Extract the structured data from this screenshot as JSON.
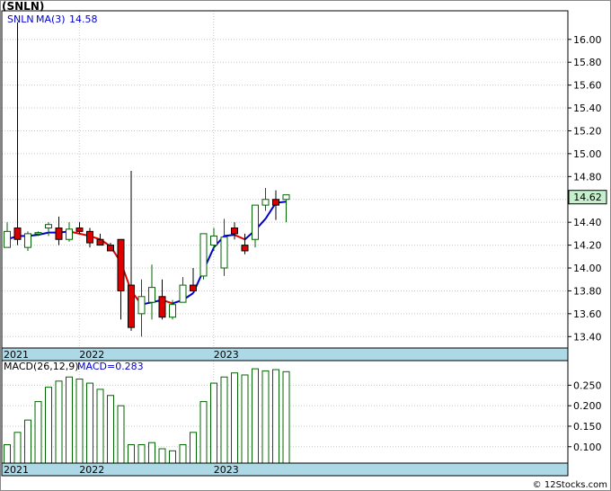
{
  "chart_data": {
    "type": "candlestick",
    "title": "(SNLN)",
    "ticker": "SNLN",
    "ma_label": "MA(3)",
    "ma_value": "14.58",
    "last_price": "14.62",
    "macd_label": "MACD(26,12,9)",
    "macd_value": "MACD=0.283",
    "year_labels": [
      {
        "label": "2021",
        "index": 0
      },
      {
        "label": "2022",
        "index": 7.5
      },
      {
        "label": "2023",
        "index": 20.5
      }
    ],
    "price_axis": {
      "ylim": [
        13.3,
        16.25
      ],
      "ticks": [
        "16.00",
        "15.80",
        "15.60",
        "15.40",
        "15.20",
        "15.00",
        "14.80",
        "14.60",
        "14.40",
        "14.20",
        "14.00",
        "13.80",
        "13.60",
        "13.40"
      ]
    },
    "macd_axis": {
      "ylim": [
        0.06,
        0.31
      ],
      "ticks": [
        "0.250",
        "0.200",
        "0.150",
        "0.100"
      ]
    },
    "colors": {
      "up_fill": "#ffffff",
      "up_stroke": "#006400",
      "down_fill": "#dd0000",
      "ma_up": "#0000cc",
      "ma_down": "#dd0000",
      "band": "#add8e6",
      "macd_stroke": "#006400",
      "grid": "#c8c8c8",
      "last_price_bg": "#c6efce"
    },
    "candles": [
      {
        "o": 14.18,
        "h": 14.4,
        "l": 14.18,
        "c": 14.32
      },
      {
        "o": 14.35,
        "h": 16.15,
        "l": 14.2,
        "c": 14.25
      },
      {
        "o": 14.18,
        "h": 14.32,
        "l": 14.15,
        "c": 14.3
      },
      {
        "o": 14.3,
        "h": 14.32,
        "l": 14.28,
        "c": 14.31
      },
      {
        "o": 14.35,
        "h": 14.4,
        "l": 14.28,
        "c": 14.38
      },
      {
        "o": 14.35,
        "h": 14.45,
        "l": 14.2,
        "c": 14.25
      },
      {
        "o": 14.25,
        "h": 14.4,
        "l": 14.23,
        "c": 14.34
      },
      {
        "o": 14.35,
        "h": 14.4,
        "l": 14.3,
        "c": 14.32
      },
      {
        "o": 14.32,
        "h": 14.35,
        "l": 14.18,
        "c": 14.22
      },
      {
        "o": 14.25,
        "h": 14.3,
        "l": 14.2,
        "c": 14.2
      },
      {
        "o": 14.2,
        "h": 14.22,
        "l": 14.15,
        "c": 14.15
      },
      {
        "o": 14.25,
        "h": 14.25,
        "l": 13.55,
        "c": 13.8
      },
      {
        "o": 13.85,
        "h": 14.85,
        "l": 13.45,
        "c": 13.48
      },
      {
        "o": 13.6,
        "h": 13.9,
        "l": 13.4,
        "c": 13.75
      },
      {
        "o": 13.7,
        "h": 14.03,
        "l": 13.55,
        "c": 13.83
      },
      {
        "o": 13.75,
        "h": 13.9,
        "l": 13.55,
        "c": 13.57
      },
      {
        "o": 13.57,
        "h": 13.72,
        "l": 13.55,
        "c": 13.68
      },
      {
        "o": 13.7,
        "h": 13.92,
        "l": 13.7,
        "c": 13.85
      },
      {
        "o": 13.85,
        "h": 14.0,
        "l": 13.8,
        "c": 13.8
      },
      {
        "o": 13.93,
        "h": 14.1,
        "l": 13.9,
        "c": 14.3
      },
      {
        "o": 14.2,
        "h": 14.35,
        "l": 14.15,
        "c": 14.28
      },
      {
        "o": 14.0,
        "h": 14.43,
        "l": 13.93,
        "c": 14.27
      },
      {
        "o": 14.35,
        "h": 14.4,
        "l": 14.25,
        "c": 14.3
      },
      {
        "o": 14.2,
        "h": 14.3,
        "l": 14.12,
        "c": 14.15
      },
      {
        "o": 14.25,
        "h": 14.55,
        "l": 14.18,
        "c": 14.55
      },
      {
        "o": 14.55,
        "h": 14.7,
        "l": 14.5,
        "c": 14.6
      },
      {
        "o": 14.6,
        "h": 14.68,
        "l": 14.42,
        "c": 14.55
      },
      {
        "o": 14.6,
        "h": 14.64,
        "l": 14.4,
        "c": 14.64
      }
    ],
    "ma": [
      14.25,
      14.28,
      14.28,
      14.29,
      14.31,
      14.31,
      14.32,
      14.3,
      14.28,
      14.25,
      14.19,
      14.05,
      13.8,
      13.68,
      13.7,
      13.72,
      13.69,
      13.72,
      13.78,
      13.98,
      14.18,
      14.28,
      14.29,
      14.25,
      14.33,
      14.43,
      14.57,
      14.58
    ],
    "macd": [
      0.105,
      0.135,
      0.165,
      0.21,
      0.245,
      0.26,
      0.27,
      0.265,
      0.255,
      0.24,
      0.225,
      0.2,
      0.105,
      0.105,
      0.11,
      0.095,
      0.09,
      0.105,
      0.135,
      0.21,
      0.255,
      0.27,
      0.28,
      0.275,
      0.29,
      0.285,
      0.288,
      0.283
    ]
  }
}
